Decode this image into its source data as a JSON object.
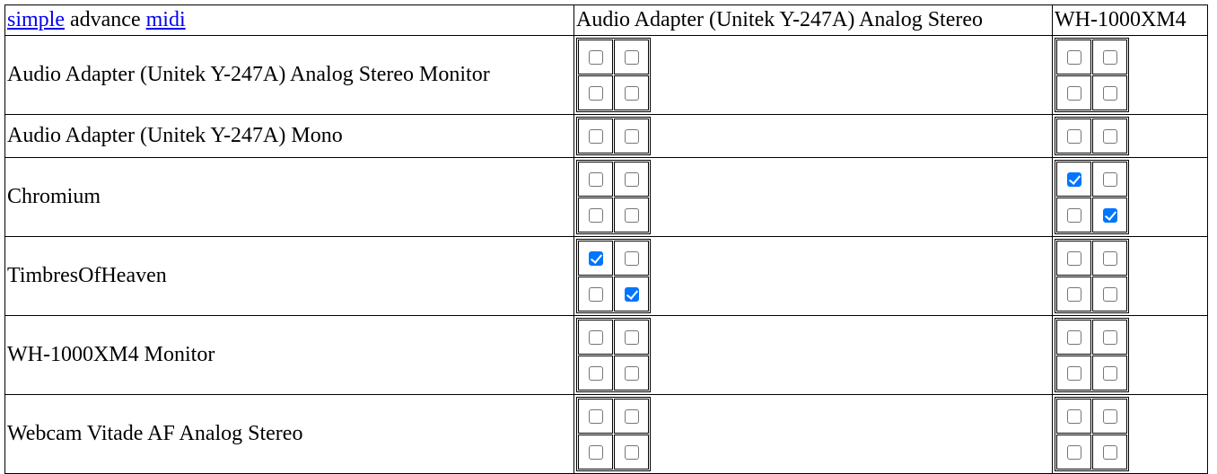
{
  "header": {
    "links": {
      "simple": "simple",
      "advance": "advance",
      "midi": "midi"
    },
    "columns": [
      "Audio Adapter (Unitek Y-247A) Analog Stereo",
      "WH-1000XM4"
    ]
  },
  "rows": [
    {
      "label": "Audio Adapter (Unitek Y-247A) Analog Stereo Monitor"
    },
    {
      "label": "Audio Adapter (Unitek Y-247A) Mono"
    },
    {
      "label": "Chromium"
    },
    {
      "label": "TimbresOfHeaven"
    },
    {
      "label": "WH-1000XM4 Monitor"
    },
    {
      "label": "Webcam Vitade AF Analog Stereo"
    }
  ],
  "connections": [
    [
      [
        [
          false,
          false
        ],
        [
          false,
          false
        ]
      ],
      [
        [
          false,
          false
        ],
        [
          false,
          false
        ]
      ]
    ],
    [
      [
        [
          false,
          false
        ]
      ],
      [
        [
          false,
          false
        ]
      ]
    ],
    [
      [
        [
          false,
          false
        ],
        [
          false,
          false
        ]
      ],
      [
        [
          true,
          false
        ],
        [
          false,
          true
        ]
      ]
    ],
    [
      [
        [
          true,
          false
        ],
        [
          false,
          true
        ]
      ],
      [
        [
          false,
          false
        ],
        [
          false,
          false
        ]
      ]
    ],
    [
      [
        [
          false,
          false
        ],
        [
          false,
          false
        ]
      ],
      [
        [
          false,
          false
        ],
        [
          false,
          false
        ]
      ]
    ],
    [
      [
        [
          false,
          false
        ],
        [
          false,
          false
        ]
      ],
      [
        [
          false,
          false
        ],
        [
          false,
          false
        ]
      ]
    ]
  ],
  "colors": {
    "checked": "#0075ff",
    "link": "#0000ee"
  }
}
